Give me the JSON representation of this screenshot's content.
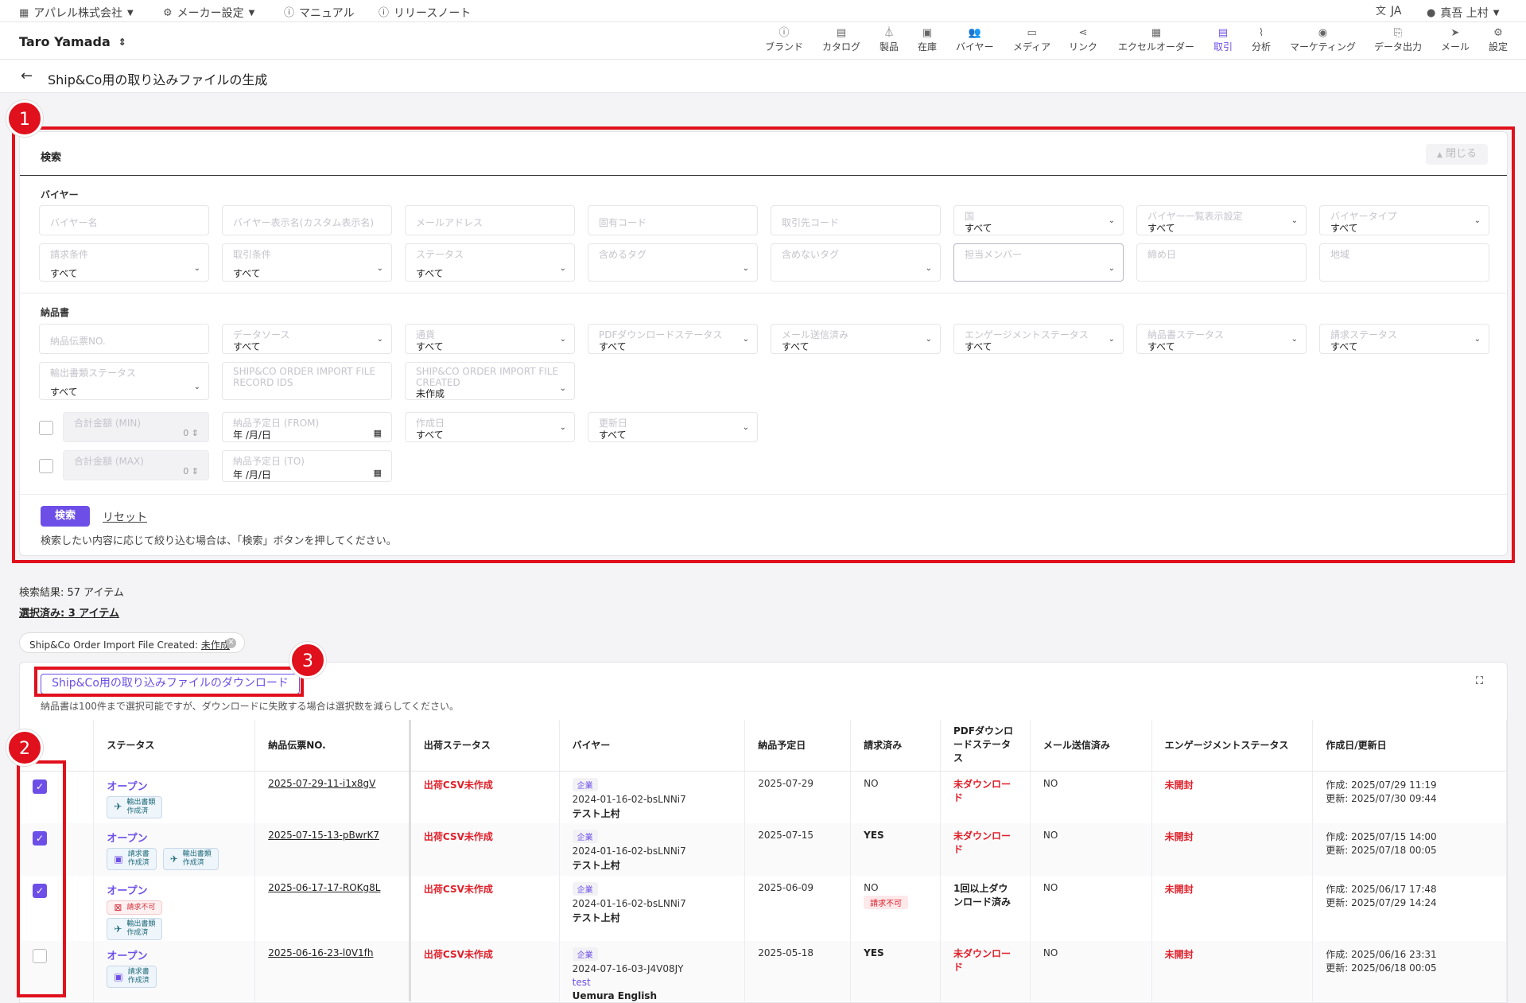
{
  "top": {
    "company": "アパレル株式会社",
    "maker_settings": "メーカー設定",
    "manual": "マニュアル",
    "release_notes": "リリースノート",
    "lang": "JA",
    "account": "真吾 上村"
  },
  "nav": {
    "user": "Taro Yamada",
    "items": [
      "ブランド",
      "カタログ",
      "製品",
      "在庫",
      "バイヤー",
      "メディア",
      "リンク",
      "エクセルオーダー",
      "取引",
      "分析",
      "マーケティング",
      "データ出力",
      "メール",
      "設定"
    ]
  },
  "page": {
    "title": "Ship&Co用の取り込みファイルの生成"
  },
  "search": {
    "title": "検索",
    "close": "閉じる",
    "buyer_section": "バイヤー",
    "delivery_section": "納品書",
    "buyer_name": "バイヤー名",
    "buyer_display_name": "バイヤー表示名(カスタム表示名)",
    "email": "メールアドレス",
    "unique_code": "固有コード",
    "partner_code": "取引先コード",
    "country": "国",
    "buyer_list_setting": "バイヤー一覧表示設定",
    "buyer_type": "バイヤータイプ",
    "billing_terms": "請求条件",
    "trade_terms": "取引条件",
    "status": "ステータス",
    "include_tags": "含めるタグ",
    "exclude_tags": "含めないタグ",
    "assignee": "担当メンバー",
    "closing_date": "締め日",
    "region": "地域",
    "slip_no": "納品伝票NO.",
    "data_source": "データソース",
    "currency": "通貨",
    "pdf_status": "PDFダウンロードステータス",
    "mail_sent": "メール送信済み",
    "engagement_status": "エンゲージメントステータス",
    "delivery_status": "納品書ステータス",
    "billing_status": "請求ステータス",
    "export_doc_status": "輸出書類ステータス",
    "shipco_ids": "SHIP&CO ORDER IMPORT FILE RECORD IDS",
    "shipco_created": "SHIP&CO ORDER IMPORT FILE CREATED",
    "shipco_created_value": "未作成",
    "total_min": "合計金額 (MIN)",
    "total_max": "合計金額 (MAX)",
    "zero": "0",
    "date_from": "納品予定日 (FROM)",
    "date_to": "納品予定日 (TO)",
    "date_placeholder": "年 /月/日",
    "created_date": "作成日",
    "updated_date": "更新日",
    "all": "すべて",
    "search_button": "検索",
    "reset": "リセット",
    "hint": "検索したい内容に応じて絞り込む場合は、「検索」ボタンを押してください。"
  },
  "results": {
    "count": "検索結果: 57 アイテム",
    "selected": "選択済み: 3 アイテム",
    "chip_label": "Ship&Co Order Import File Created: ",
    "chip_value": "未作成",
    "download_button": "Ship&Co用の取り込みファイルのダウンロード",
    "download_hint": "納品書は100件まで選択可能ですが、ダウンロードに失敗する場合は選択数を減らしてください。"
  },
  "table": {
    "headers": [
      "ステータス",
      "納品伝票NO.",
      "出荷ステータス",
      "バイヤー",
      "納品予定日",
      "請求済み",
      "PDFダウンロードステータス",
      "メール送信済み",
      "エンゲージメントステータス",
      "作成日/更新日"
    ],
    "badge_export": [
      "輸出書類",
      "作成済"
    ],
    "badge_invoice": [
      "請求書",
      "作成済"
    ],
    "badge_ng": "請求不可",
    "rows": [
      {
        "status": "オープン",
        "slip": "2025-07-29-11-i1x8gV",
        "ship": "出荷CSV未作成",
        "buyer_tag": "企業",
        "buyer_code": "2024-01-16-02-bsLNNi7",
        "buyer_name": "テスト上村",
        "buyer_link": "",
        "date": "2025-07-29",
        "billed": "NO",
        "billed_note": "",
        "pdf": "未ダウンロード",
        "mail": "NO",
        "engage": "未開封",
        "created": "作成: 2025/07/29 11:19",
        "updated": "更新: 2025/07/30 09:44"
      },
      {
        "status": "オープン",
        "slip": "2025-07-15-13-pBwrK7",
        "ship": "出荷CSV未作成",
        "buyer_tag": "企業",
        "buyer_code": "2024-01-16-02-bsLNNi7",
        "buyer_name": "テスト上村",
        "buyer_link": "",
        "date": "2025-07-15",
        "billed": "YES",
        "billed_note": "",
        "pdf": "未ダウンロード",
        "mail": "NO",
        "engage": "未開封",
        "created": "作成: 2025/07/15 14:00",
        "updated": "更新: 2025/07/18 00:05"
      },
      {
        "status": "オープン",
        "slip": "2025-06-17-17-ROKg8L",
        "ship": "出荷CSV未作成",
        "buyer_tag": "企業",
        "buyer_code": "2024-01-16-02-bsLNNi7",
        "buyer_name": "テスト上村",
        "buyer_link": "",
        "date": "2025-06-09",
        "billed": "NO",
        "billed_note": "請求不可",
        "pdf": "1回以上ダウンロード済み",
        "mail": "NO",
        "engage": "未開封",
        "created": "作成: 2025/06/17 17:48",
        "updated": "更新: 2025/07/29 14:24"
      },
      {
        "status": "オープン",
        "slip": "2025-06-16-23-l0V1fh",
        "ship": "出荷CSV未作成",
        "buyer_tag": "企業",
        "buyer_code": "2024-07-16-03-J4V08JY",
        "buyer_name": "Uemura English",
        "buyer_link": "test",
        "date": "2025-05-18",
        "billed": "YES",
        "billed_note": "",
        "pdf": "未ダウンロード",
        "mail": "NO",
        "engage": "未開封",
        "created": "作成: 2025/06/16 23:31",
        "updated": "更新: 2025/06/18 00:05"
      }
    ]
  },
  "annotations": [
    "1",
    "2",
    "3"
  ]
}
